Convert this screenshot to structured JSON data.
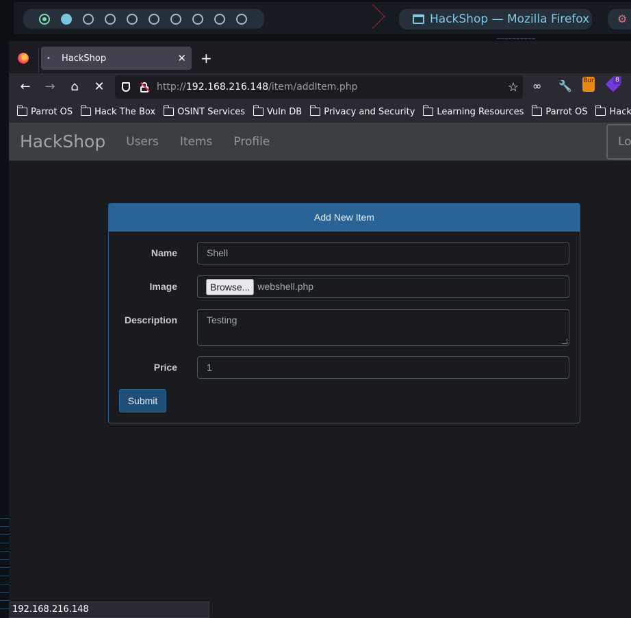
{
  "desktop": {
    "window_title": "HackShop — Mozilla Firefox"
  },
  "browser": {
    "tab": {
      "title": "HackShop"
    },
    "url": {
      "scheme": "http://",
      "host": "192.168.216.148",
      "path": "/item/addItem.php"
    },
    "bookmarks": [
      {
        "label": "Parrot OS"
      },
      {
        "label": "Hack The Box"
      },
      {
        "label": "OSINT Services"
      },
      {
        "label": "Vuln DB"
      },
      {
        "label": "Privacy and Security"
      },
      {
        "label": "Learning Resources"
      },
      {
        "label": "Parrot OS"
      },
      {
        "label": "Hack The Box"
      }
    ],
    "extensions": {
      "burp_label": "Bur",
      "badge_count": "8"
    },
    "status_url": "192.168.216.148"
  },
  "site": {
    "brand": "HackShop",
    "nav": {
      "users": "Users",
      "items": "Items",
      "profile": "Profile",
      "login": "Login"
    }
  },
  "form": {
    "header": "Add New Item",
    "name": {
      "label": "Name",
      "value": "Shell"
    },
    "image": {
      "label": "Image",
      "button": "Browse...",
      "file": "webshell.php"
    },
    "description": {
      "label": "Description",
      "value": "Testing"
    },
    "price": {
      "label": "Price",
      "value": "1"
    },
    "submit": "Submit"
  }
}
